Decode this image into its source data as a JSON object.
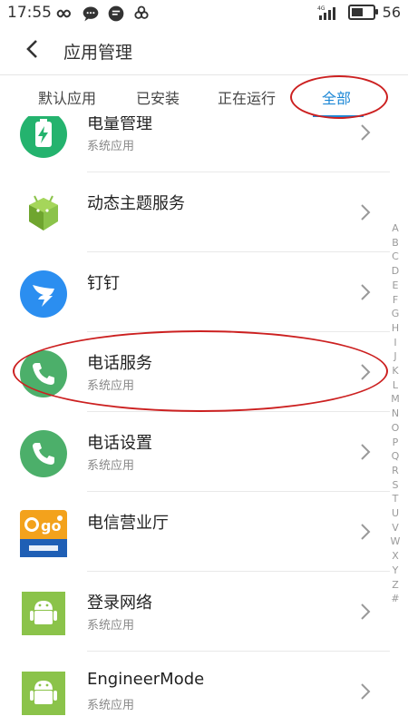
{
  "status_bar": {
    "time": "17:55",
    "network": "4G",
    "battery_level": "56"
  },
  "header": {
    "title": "应用管理"
  },
  "tabs": [
    {
      "label": "默认应用",
      "active": false
    },
    {
      "label": "已安装",
      "active": false
    },
    {
      "label": "正在运行",
      "active": false
    },
    {
      "label": "全部",
      "active": true
    }
  ],
  "apps": [
    {
      "name": "电量管理",
      "subtitle": "系统应用",
      "icon": "battery-manager-icon"
    },
    {
      "name": "动态主题服务",
      "subtitle": "",
      "icon": "android-cube-icon"
    },
    {
      "name": "钉钉",
      "subtitle": "",
      "icon": "dingtalk-icon"
    },
    {
      "name": "电话服务",
      "subtitle": "系统应用",
      "icon": "phone-icon"
    },
    {
      "name": "电话设置",
      "subtitle": "系统应用",
      "icon": "phone-icon"
    },
    {
      "name": "电信营业厅",
      "subtitle": "",
      "icon": "telecom-go-icon"
    },
    {
      "name": "登录网络",
      "subtitle": "系统应用",
      "icon": "android-icon"
    },
    {
      "name": "EngineerMode",
      "subtitle": "系统应用",
      "icon": "android-icon"
    }
  ],
  "alphabet": [
    "A",
    "B",
    "C",
    "D",
    "E",
    "F",
    "G",
    "H",
    "I",
    "J",
    "K",
    "L",
    "M",
    "N",
    "O",
    "P",
    "Q",
    "R",
    "S",
    "T",
    "U",
    "V",
    "W",
    "X",
    "Y",
    "Z",
    "#"
  ],
  "colors": {
    "accent": "#1e88d6",
    "annotation": "#cc2020",
    "phone_green": "#4caf6a",
    "android_green": "#8bc34a"
  }
}
